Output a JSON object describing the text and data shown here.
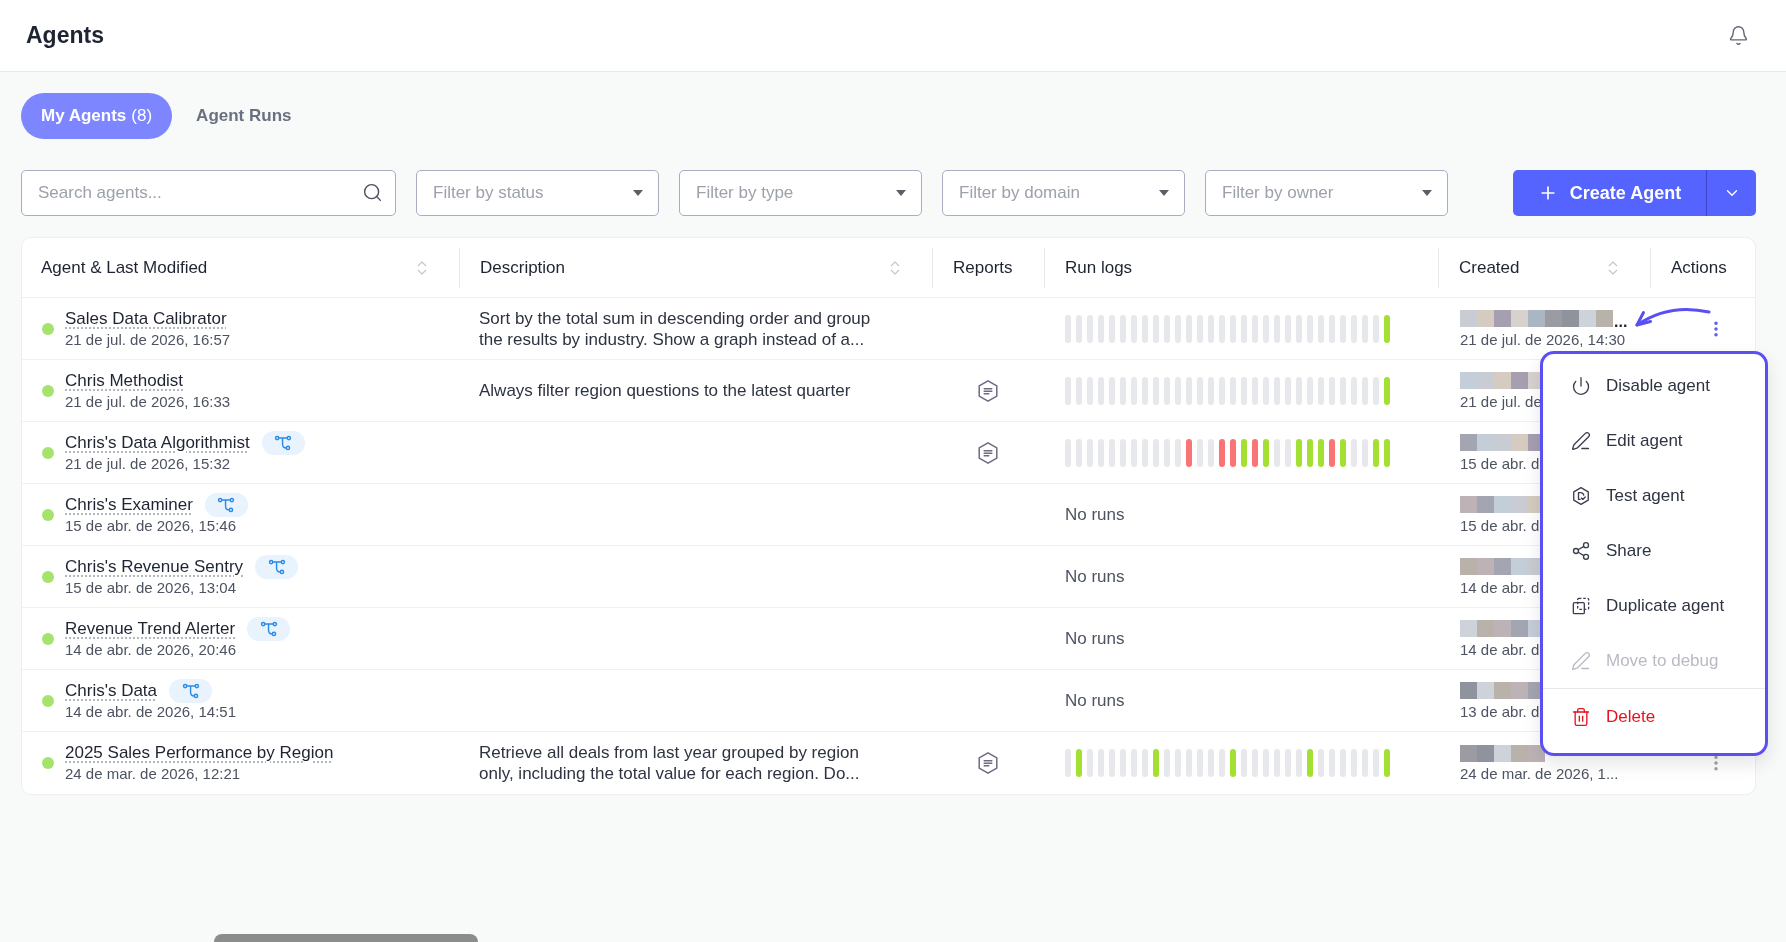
{
  "header": {
    "title": "Agents"
  },
  "tabs": [
    {
      "label": "My Agents",
      "count": "(8)",
      "selected": true
    },
    {
      "label": "Agent Runs",
      "selected": false
    }
  ],
  "search": {
    "placeholder": "Search agents..."
  },
  "filters": [
    {
      "placeholder": "Filter by status"
    },
    {
      "placeholder": "Filter by type"
    },
    {
      "placeholder": "Filter by domain"
    },
    {
      "placeholder": "Filter by owner"
    }
  ],
  "create_button": {
    "label": "Create Agent"
  },
  "table": {
    "columns": [
      {
        "label": "Agent & Last Modified",
        "sortable": true
      },
      {
        "label": "Description",
        "sortable": true
      },
      {
        "label": "Reports",
        "sortable": false
      },
      {
        "label": "Run logs",
        "sortable": false
      },
      {
        "label": "Created",
        "sortable": true
      },
      {
        "label": "Actions",
        "sortable": false
      }
    ],
    "rows": [
      {
        "name": "Sales Data Calibrator",
        "modified": "21 de jul. de 2026, 16:57",
        "active": true,
        "workflow": false,
        "description": "Sort by the total sum in descending order and group the results by industry. Show a graph instead of a...",
        "report": false,
        "runs": [
          {
            "color": "#e7e8eb"
          },
          {
            "color": "#e7e8eb"
          },
          {
            "color": "#e7e8eb"
          },
          {
            "color": "#e7e8eb"
          },
          {
            "color": "#e7e8eb"
          },
          {
            "color": "#e7e8eb"
          },
          {
            "color": "#e7e8eb"
          },
          {
            "color": "#e7e8eb"
          },
          {
            "color": "#e7e8eb"
          },
          {
            "color": "#e7e8eb"
          },
          {
            "color": "#e7e8eb"
          },
          {
            "color": "#e7e8eb"
          },
          {
            "color": "#e7e8eb"
          },
          {
            "color": "#e7e8eb"
          },
          {
            "color": "#e7e8eb"
          },
          {
            "color": "#e7e8eb"
          },
          {
            "color": "#e7e8eb"
          },
          {
            "color": "#e7e8eb"
          },
          {
            "color": "#e7e8eb"
          },
          {
            "color": "#e7e8eb"
          },
          {
            "color": "#e7e8eb"
          },
          {
            "color": "#e7e8eb"
          },
          {
            "color": "#e7e8eb"
          },
          {
            "color": "#e7e8eb"
          },
          {
            "color": "#e7e8eb"
          },
          {
            "color": "#e7e8eb"
          },
          {
            "color": "#e7e8eb"
          },
          {
            "color": "#e7e8eb"
          },
          {
            "color": "#e7e8eb"
          },
          {
            "color": "#a4e034"
          }
        ],
        "created": {
          "name_tail": "...",
          "date": "21 de jul. de 2026, 14:30"
        },
        "actions": {
          "selected": true
        }
      },
      {
        "name": "Chris Methodist",
        "modified": "21 de jul. de 2026, 16:33",
        "active": true,
        "workflow": false,
        "description": "Always filter region questions to the latest quarter",
        "report": true,
        "runs": [
          {
            "color": "#e7e8eb"
          },
          {
            "color": "#e7e8eb"
          },
          {
            "color": "#e7e8eb"
          },
          {
            "color": "#e7e8eb"
          },
          {
            "color": "#e7e8eb"
          },
          {
            "color": "#e7e8eb"
          },
          {
            "color": "#e7e8eb"
          },
          {
            "color": "#e7e8eb"
          },
          {
            "color": "#e7e8eb"
          },
          {
            "color": "#e7e8eb"
          },
          {
            "color": "#e7e8eb"
          },
          {
            "color": "#e7e8eb"
          },
          {
            "color": "#e7e8eb"
          },
          {
            "color": "#e7e8eb"
          },
          {
            "color": "#e7e8eb"
          },
          {
            "color": "#e7e8eb"
          },
          {
            "color": "#e7e8eb"
          },
          {
            "color": "#e7e8eb"
          },
          {
            "color": "#e7e8eb"
          },
          {
            "color": "#e7e8eb"
          },
          {
            "color": "#e7e8eb"
          },
          {
            "color": "#e7e8eb"
          },
          {
            "color": "#e7e8eb"
          },
          {
            "color": "#e7e8eb"
          },
          {
            "color": "#e7e8eb"
          },
          {
            "color": "#e7e8eb"
          },
          {
            "color": "#e7e8eb"
          },
          {
            "color": "#e7e8eb"
          },
          {
            "color": "#e7e8eb"
          },
          {
            "color": "#a4e034"
          }
        ],
        "created": {
          "date": "21 de jul. de"
        }
      },
      {
        "name": "Chris's Data Algorithmist",
        "modified": "21 de jul. de 2026, 15:32",
        "active": true,
        "workflow": true,
        "report": true,
        "runs": [
          {
            "color": "#e7e8eb"
          },
          {
            "color": "#e7e8eb"
          },
          {
            "color": "#e7e8eb"
          },
          {
            "color": "#e7e8eb"
          },
          {
            "color": "#e7e8eb"
          },
          {
            "color": "#e7e8eb"
          },
          {
            "color": "#e7e8eb"
          },
          {
            "color": "#e7e8eb"
          },
          {
            "color": "#e7e8eb"
          },
          {
            "color": "#e7e8eb"
          },
          {
            "color": "#e7e8eb"
          },
          {
            "color": "#fa7375"
          },
          {
            "color": "#e7e8eb"
          },
          {
            "color": "#e7e8eb"
          },
          {
            "color": "#fa7375"
          },
          {
            "color": "#fa7375"
          },
          {
            "color": "#a4e034"
          },
          {
            "color": "#fa7375"
          },
          {
            "color": "#a4e034"
          },
          {
            "color": "#e7e8eb"
          },
          {
            "color": "#e7e8eb"
          },
          {
            "color": "#a4e034"
          },
          {
            "color": "#a4e034"
          },
          {
            "color": "#a4e034"
          },
          {
            "color": "#fa7375"
          },
          {
            "color": "#a4e034"
          },
          {
            "color": "#e7e8eb"
          },
          {
            "color": "#e7e8eb"
          },
          {
            "color": "#a4e034"
          },
          {
            "color": "#a4e034"
          }
        ],
        "created": {
          "date": "15 de abr. d"
        }
      },
      {
        "name": "Chris's Examiner",
        "modified": "15 de abr. de 2026, 15:46",
        "active": true,
        "workflow": true,
        "report": false,
        "run_logs": "No runs",
        "created": {
          "date": "15 de abr. d"
        }
      },
      {
        "name": "Chris's Revenue Sentry",
        "modified": "15 de abr. de 2026, 13:04",
        "active": true,
        "workflow": true,
        "report": false,
        "run_logs": "No runs",
        "created": {
          "date": "14 de abr. d"
        }
      },
      {
        "name": "Revenue Trend Alerter",
        "modified": "14 de abr. de 2026, 20:46",
        "active": true,
        "workflow": true,
        "report": false,
        "run_logs": "No runs",
        "created": {
          "date": "14 de abr. d"
        }
      },
      {
        "name": "Chris's Data",
        "modified": "14 de abr. de 2026, 14:51",
        "active": true,
        "workflow": true,
        "report": false,
        "run_logs": "No runs",
        "created": {
          "date": "13 de abr. d"
        }
      },
      {
        "name": "2025 Sales Performance by Region",
        "modified": "24 de mar. de 2026, 12:21",
        "active": true,
        "workflow": false,
        "description": "Retrieve all deals from last year grouped by region only, including the total value for each region. Do...",
        "report": true,
        "runs": [
          {
            "color": "#e7e8eb"
          },
          {
            "color": "#a4e034"
          },
          {
            "color": "#e7e8eb"
          },
          {
            "color": "#e7e8eb"
          },
          {
            "color": "#e7e8eb"
          },
          {
            "color": "#e7e8eb"
          },
          {
            "color": "#e7e8eb"
          },
          {
            "color": "#e7e8eb"
          },
          {
            "color": "#a4e034"
          },
          {
            "color": "#e7e8eb"
          },
          {
            "color": "#e7e8eb"
          },
          {
            "color": "#e7e8eb"
          },
          {
            "color": "#e7e8eb"
          },
          {
            "color": "#e7e8eb"
          },
          {
            "color": "#e7e8eb"
          },
          {
            "color": "#a4e034"
          },
          {
            "color": "#e7e8eb"
          },
          {
            "color": "#e7e8eb"
          },
          {
            "color": "#e7e8eb"
          },
          {
            "color": "#e7e8eb"
          },
          {
            "color": "#e7e8eb"
          },
          {
            "color": "#e7e8eb"
          },
          {
            "color": "#a4e034"
          },
          {
            "color": "#e7e8eb"
          },
          {
            "color": "#e7e8eb"
          },
          {
            "color": "#e7e8eb"
          },
          {
            "color": "#e7e8eb"
          },
          {
            "color": "#e7e8eb"
          },
          {
            "color": "#e7e8eb"
          },
          {
            "color": "#a4e034"
          }
        ],
        "created": {
          "date": "24 de mar. de 2026, 1..."
        },
        "actions": {
          "selected": false
        }
      }
    ]
  },
  "menu": {
    "items": [
      {
        "label": "Disable agent",
        "kind": "action",
        "disabled": false
      },
      {
        "label": "Edit agent",
        "kind": "action",
        "disabled": false
      },
      {
        "label": "Test agent",
        "kind": "action",
        "disabled": false
      },
      {
        "label": "Share",
        "kind": "action",
        "disabled": false
      },
      {
        "label": "Duplicate agent",
        "kind": "action",
        "disabled": false
      },
      {
        "label": "Move to debug",
        "kind": "action",
        "disabled": true
      },
      {
        "label": "Delete",
        "kind": "danger",
        "disabled": false
      }
    ]
  }
}
